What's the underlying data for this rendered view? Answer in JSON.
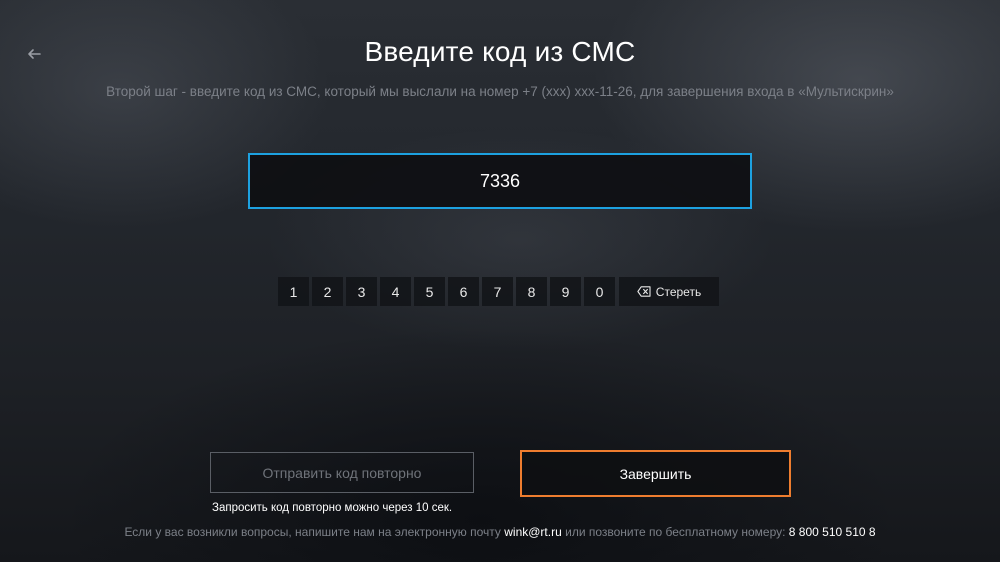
{
  "header": {
    "back_icon": "arrow-left-icon",
    "title": "Введите код из СМС",
    "subtitle": "Второй шаг - введите код из СМС, который мы выслали на номер +7 (xxx) xxx-11-26, для завершения входа в «Мультискрин»"
  },
  "code_input": {
    "value": "7336"
  },
  "keypad": {
    "keys": [
      "1",
      "2",
      "3",
      "4",
      "5",
      "6",
      "7",
      "8",
      "9",
      "0"
    ],
    "erase_label": "Стереть",
    "erase_icon": "backspace-icon"
  },
  "actions": {
    "resend_label": "Отправить код повторно",
    "finish_label": "Завершить",
    "resend_hint": "Запросить код повторно можно через 10 сек."
  },
  "footer": {
    "text_before_email": "Если у вас возникли вопросы, напишите нам на электронную почту",
    "email": "wink@rt.ru",
    "text_before_phone": "или позвоните по бесплатному номеру:",
    "phone": "8 800 510 510 8"
  },
  "colors": {
    "focus_border": "#1da1e0",
    "accent_border": "#ee7d2f",
    "muted_text": "#7c8088"
  }
}
